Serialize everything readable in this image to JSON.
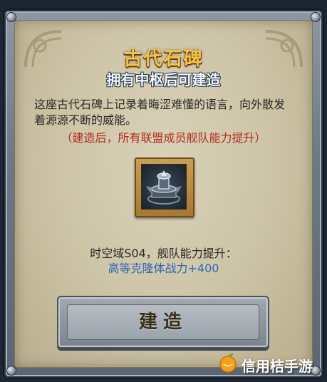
{
  "dialog": {
    "title": "古代石碑",
    "subtitle": "拥有中枢后可建造",
    "description": "这座古代石碑上记录着晦涩难懂的语言，向外散发着源源不断的威能。",
    "note": "（建造后，所有联盟成员舰队能力提升）",
    "item_icon": "ancient-monument-icon",
    "bonus_text": "时空域S04，舰队能力提升：",
    "bonus_value": "高等克隆体战力+400",
    "build_button_label": "建造"
  },
  "watermark": {
    "text": "信用桔手游",
    "icon": "orange-logo-icon"
  },
  "colors": {
    "title": "#f3c44a",
    "note": "#b02a1f",
    "bonus_value": "#2c67b8",
    "panel": "#d2c9ad"
  }
}
